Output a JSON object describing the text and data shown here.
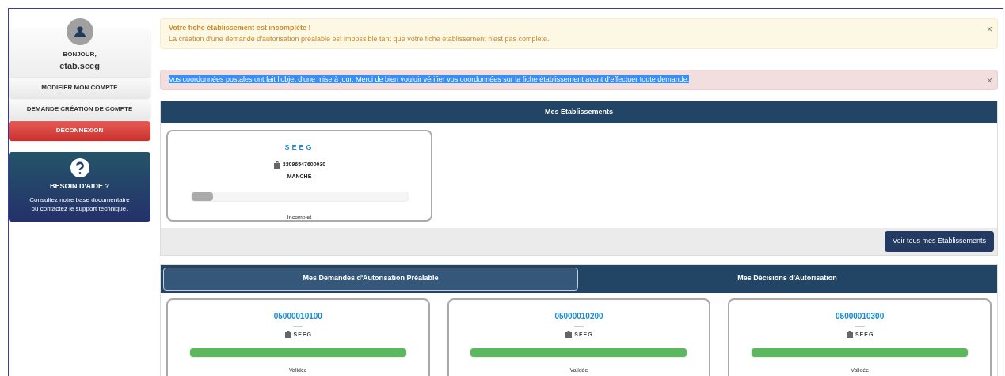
{
  "user": {
    "greeting": "BONJOUR,",
    "username": "etab.seeg"
  },
  "account_menu": [
    {
      "label": "MODIFIER MON COMPTE",
      "kind": "default"
    },
    {
      "label": "DEMANDE CRÉATION DE COMPTE",
      "kind": "default"
    },
    {
      "label": "DÉCONNEXION",
      "kind": "danger"
    }
  ],
  "help": {
    "title": "BESOIN D'AIDE ?",
    "lines": [
      "Consultez notre base documentaire",
      "ou contactez le support technique."
    ]
  },
  "alerts": [
    {
      "kind": "warning",
      "title": "Votre fiche établissement est incomplète !",
      "message": "La création d'une demande d'autorisation préalable est impossible tant que votre fiche établissement n'est pas complète.",
      "highlighted": false,
      "close": "×"
    },
    {
      "kind": "danger",
      "message": "Vos coordonnées postales ont fait l'objet d'une mise à jour. Merci de bien vouloir vérifier vos coordonnées sur la fiche établissement avant d'effectuer toute demande.",
      "highlighted": true,
      "close": "×"
    }
  ],
  "establishments": {
    "title": "Mes Etablissements",
    "button": "Voir tous mes Etablissements",
    "cards": [
      {
        "name": "SEEG",
        "siret": "33096547600030",
        "region": "MANCHE",
        "level": 0.1,
        "status": "Incomplet",
        "kind": "incomplete"
      }
    ]
  },
  "requests": {
    "tabs": [
      {
        "label": "Mes Demandes d'Autorisation Préalable",
        "selected": true
      },
      {
        "label": "Mes Décisions d'Autorisation",
        "selected": false
      }
    ],
    "cards": [
      {
        "number": "05000010100",
        "establishment": "SEEG",
        "level": 1,
        "status": "Validée",
        "kind": "validated"
      },
      {
        "number": "05000010200",
        "establishment": "SEEG",
        "level": 1,
        "status": "Validée",
        "kind": "validated"
      },
      {
        "number": "05000010300",
        "establishment": "SEEG",
        "level": 1,
        "status": "Validée",
        "kind": "validated"
      }
    ]
  }
}
